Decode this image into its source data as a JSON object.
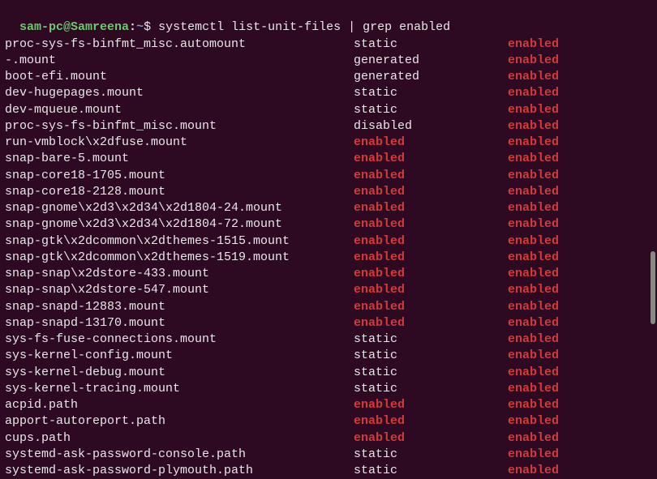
{
  "prompt": {
    "user": "sam-pc@Samreena",
    "sep": ":",
    "path": "~",
    "symbol": "$ ",
    "command": "systemctl list-unit-files | grep enabled"
  },
  "rows": [
    {
      "unit": "proc-sys-fs-binfmt_misc.automount",
      "state": "static",
      "stateColor": "white",
      "preset": "enabled"
    },
    {
      "unit": "-.mount",
      "state": "generated",
      "stateColor": "white",
      "preset": "enabled"
    },
    {
      "unit": "boot-efi.mount",
      "state": "generated",
      "stateColor": "white",
      "preset": "enabled"
    },
    {
      "unit": "dev-hugepages.mount",
      "state": "static",
      "stateColor": "white",
      "preset": "enabled"
    },
    {
      "unit": "dev-mqueue.mount",
      "state": "static",
      "stateColor": "white",
      "preset": "enabled"
    },
    {
      "unit": "proc-sys-fs-binfmt_misc.mount",
      "state": "disabled",
      "stateColor": "white",
      "preset": "enabled"
    },
    {
      "unit": "run-vmblock\\x2dfuse.mount",
      "state": "enabled",
      "stateColor": "red",
      "preset": "enabled"
    },
    {
      "unit": "snap-bare-5.mount",
      "state": "enabled",
      "stateColor": "red",
      "preset": "enabled"
    },
    {
      "unit": "snap-core18-1705.mount",
      "state": "enabled",
      "stateColor": "red",
      "preset": "enabled"
    },
    {
      "unit": "snap-core18-2128.mount",
      "state": "enabled",
      "stateColor": "red",
      "preset": "enabled"
    },
    {
      "unit": "snap-gnome\\x2d3\\x2d34\\x2d1804-24.mount",
      "state": "enabled",
      "stateColor": "red",
      "preset": "enabled"
    },
    {
      "unit": "snap-gnome\\x2d3\\x2d34\\x2d1804-72.mount",
      "state": "enabled",
      "stateColor": "red",
      "preset": "enabled"
    },
    {
      "unit": "snap-gtk\\x2dcommon\\x2dthemes-1515.mount",
      "state": "enabled",
      "stateColor": "red",
      "preset": "enabled"
    },
    {
      "unit": "snap-gtk\\x2dcommon\\x2dthemes-1519.mount",
      "state": "enabled",
      "stateColor": "red",
      "preset": "enabled"
    },
    {
      "unit": "snap-snap\\x2dstore-433.mount",
      "state": "enabled",
      "stateColor": "red",
      "preset": "enabled"
    },
    {
      "unit": "snap-snap\\x2dstore-547.mount",
      "state": "enabled",
      "stateColor": "red",
      "preset": "enabled"
    },
    {
      "unit": "snap-snapd-12883.mount",
      "state": "enabled",
      "stateColor": "red",
      "preset": "enabled"
    },
    {
      "unit": "snap-snapd-13170.mount",
      "state": "enabled",
      "stateColor": "red",
      "preset": "enabled"
    },
    {
      "unit": "sys-fs-fuse-connections.mount",
      "state": "static",
      "stateColor": "white",
      "preset": "enabled"
    },
    {
      "unit": "sys-kernel-config.mount",
      "state": "static",
      "stateColor": "white",
      "preset": "enabled"
    },
    {
      "unit": "sys-kernel-debug.mount",
      "state": "static",
      "stateColor": "white",
      "preset": "enabled"
    },
    {
      "unit": "sys-kernel-tracing.mount",
      "state": "static",
      "stateColor": "white",
      "preset": "enabled"
    },
    {
      "unit": "acpid.path",
      "state": "enabled",
      "stateColor": "red",
      "preset": "enabled"
    },
    {
      "unit": "apport-autoreport.path",
      "state": "enabled",
      "stateColor": "red",
      "preset": "enabled"
    },
    {
      "unit": "cups.path",
      "state": "enabled",
      "stateColor": "red",
      "preset": "enabled"
    },
    {
      "unit": "systemd-ask-password-console.path",
      "state": "static",
      "stateColor": "white",
      "preset": "enabled"
    },
    {
      "unit": "systemd-ask-password-plymouth.path",
      "state": "static",
      "stateColor": "white",
      "preset": "enabled"
    }
  ]
}
